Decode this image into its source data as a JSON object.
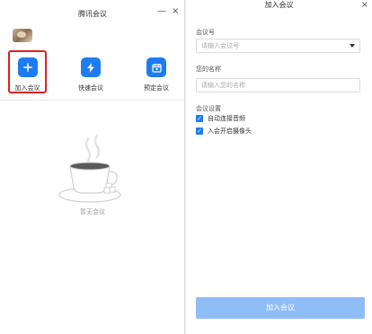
{
  "left": {
    "title": "腾讯会议",
    "minimize_glyph": "—",
    "close_glyph": "×",
    "actions": [
      {
        "label": "加入会议",
        "icon": "plus-icon"
      },
      {
        "label": "快速会议",
        "icon": "lightning-icon"
      },
      {
        "label": "预定会议",
        "icon": "calendar-icon"
      }
    ],
    "empty_text": "暂无会议"
  },
  "right": {
    "title": "加入会议",
    "close_glyph": "×",
    "meeting_id_label": "会议号",
    "meeting_id_placeholder": "请输入会议号",
    "name_label": "您的名称",
    "name_placeholder": "请输入您的名称",
    "settings_label": "会议设置",
    "options": [
      {
        "label": "自动连接音频",
        "checked": true
      },
      {
        "label": "入会开启摄像头",
        "checked": true
      }
    ],
    "join_button": "加入会议"
  },
  "colors": {
    "accent": "#1e7cf2",
    "join_button_disabled": "#8fbdf7",
    "highlight_border": "#e02020"
  }
}
